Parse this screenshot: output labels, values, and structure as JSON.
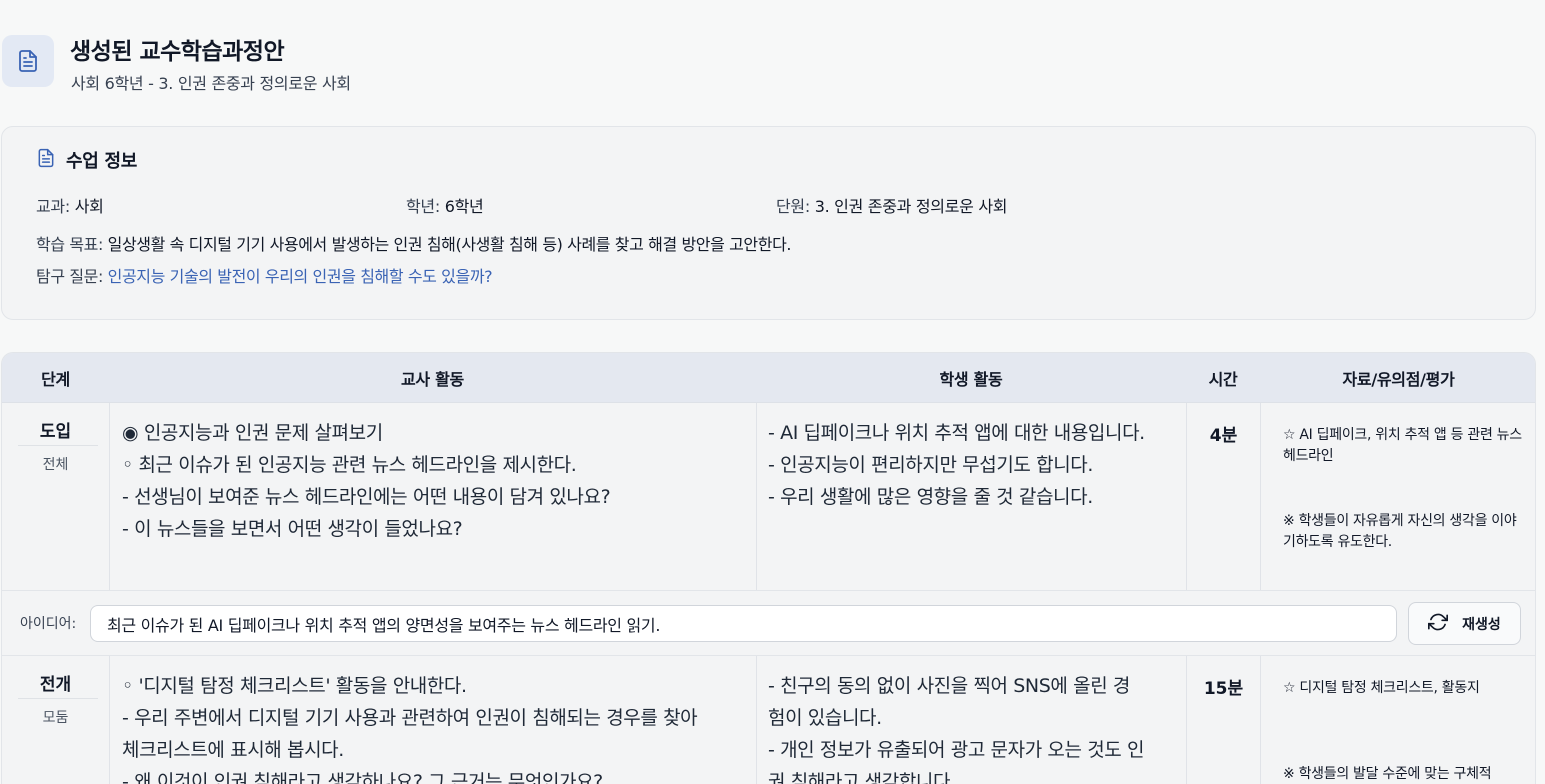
{
  "header": {
    "title": "생성된 교수학습과정안",
    "subtitle": "사회 6학년 - 3. 인권 존중과 정의로운 사회"
  },
  "info": {
    "title": "수업 정보",
    "subject_label": "교과:",
    "subject_value": "사회",
    "grade_label": "학년:",
    "grade_value": "6학년",
    "unit_label": "단원:",
    "unit_value": "3. 인권 존중과 정의로운 사회",
    "goal_label": "학습 목표:",
    "goal_value": "일상생활 속 디지털 기기 사용에서 발생하는 인권 침해(사생활 침해 등) 사례를 찾고 해결 방안을 고안한다.",
    "question_label": "탐구 질문:",
    "question_value": "인공지능 기술의 발전이 우리의 인권을 침해할 수도 있을까?"
  },
  "table": {
    "headers": [
      "단계",
      "교사 활동",
      "학생 활동",
      "시간",
      "자료/유의점/평가"
    ],
    "rows": [
      {
        "stage": "도입",
        "mode": "전체",
        "teacher": [
          "◉ 인공지능과 인권 문제 살펴보기",
          "◦ 최근 이슈가 된 인공지능 관련 뉴스 헤드라인을 제시한다.",
          "- 선생님이 보여준 뉴스 헤드라인에는 어떤 내용이 담겨 있나요?",
          "- 이 뉴스들을 보면서 어떤 생각이 들었나요?"
        ],
        "student": [
          "- AI 딥페이크나 위치 추적 앱에 대한 내용입니다.",
          "- 인공지능이 편리하지만 무섭기도 합니다.",
          "- 우리 생활에 많은 영향을 줄 것 같습니다."
        ],
        "time": "4분",
        "resource": "☆ AI 딥페이크, 위치 추적 앱 등 관련 뉴스 헤드라인",
        "note": "※ 학생들이 자유롭게 자신의 생각을 이야기하도록 유도한다."
      },
      {
        "stage": "전개",
        "mode": "모둠",
        "teacher": [
          "◦ '디지털 탐정 체크리스트' 활동을 안내한다.",
          "- 우리 주변에서 디지털 기기 사용과 관련하여 인권이 침해되는 경우를 찾아",
          "체크리스트에 표시해 봅시다.",
          "- 왜 이것이 인권 침해라고 생각하나요? 그 근거는 무엇인가요?"
        ],
        "student": [
          "- 친구의 동의 없이 사진을 찍어 SNS에 올린 경",
          "험이 있습니다.",
          "- 개인 정보가 유출되어 광고 문자가 오는 것도 인",
          "권 침해라고 생각합니다."
        ],
        "time": "15분",
        "resource": "☆ 디지털 탐정 체크리스트, 활동지",
        "note": "※ 학생들의 발달 수준에 맞는 구체적"
      }
    ],
    "idea": {
      "label": "아이디어:",
      "value": "최근 이슈가 된 AI 딥페이크나 위치 추적 앱의 양면성을 보여주는 뉴스 헤드라인 읽기.",
      "regenerate_label": "재생성"
    }
  }
}
